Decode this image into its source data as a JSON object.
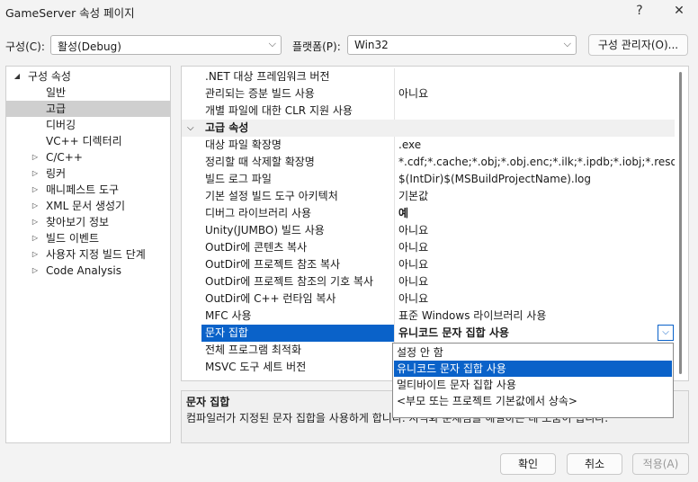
{
  "window": {
    "title": "GameServer 속성 페이지",
    "help": "?",
    "close": "✕"
  },
  "toolbar": {
    "config_label": "구성(C):",
    "config_value": "활성(Debug)",
    "platform_label": "플랫폼(P):",
    "platform_value": "Win32",
    "manager_button": "구성 관리자(O)..."
  },
  "tree": {
    "root": "구성 속성",
    "items": [
      "일반",
      "고급",
      "디버깅",
      "VC++ 디렉터리",
      "C/C++",
      "링커",
      "매니페스트 도구",
      "XML 문서 생성기",
      "찾아보기 정보",
      "빌드 이벤트",
      "사용자 지정 빌드 단계",
      "Code Analysis"
    ]
  },
  "grid": {
    "rows_top": [
      {
        "name": ".NET 대상 프레임워크 버전",
        "value": ""
      },
      {
        "name": "관리되는 증분 빌드 사용",
        "value": "아니요"
      },
      {
        "name": "개별 파일에 대한 CLR 지원 사용",
        "value": ""
      }
    ],
    "category": "고급 속성",
    "rows": [
      {
        "name": "대상 파일 확장명",
        "value": ".exe"
      },
      {
        "name": "정리할 때 삭제할 확장명",
        "value": "*.cdf;*.cache;*.obj;*.obj.enc;*.ilk;*.ipdb;*.iobj;*.resources;*.t"
      },
      {
        "name": "빌드 로그 파일",
        "value": "$(IntDir)$(MSBuildProjectName).log"
      },
      {
        "name": "기본 설정 빌드 도구 아키텍처",
        "value": "기본값"
      },
      {
        "name": "디버그 라이브러리 사용",
        "value": "예"
      },
      {
        "name": "Unity(JUMBO) 빌드 사용",
        "value": "아니요"
      },
      {
        "name": "OutDir에 콘텐츠 복사",
        "value": "아니요"
      },
      {
        "name": "OutDir에 프로젝트 참조 복사",
        "value": "아니요"
      },
      {
        "name": "OutDir에 프로젝트 참조의 기호 복사",
        "value": "아니요"
      },
      {
        "name": "OutDir에 C++ 런타임 복사",
        "value": "아니요"
      },
      {
        "name": "MFC 사용",
        "value": "표준 Windows 라이브러리 사용"
      },
      {
        "name": "문자 집합",
        "value": "유니코드 문자 집합 사용"
      },
      {
        "name": "전체 프로그램 최적화",
        "value": ""
      },
      {
        "name": "MSVC 도구 세트 버전",
        "value": ""
      }
    ]
  },
  "dropdown": {
    "options": [
      "설정 안 함",
      "유니코드 문자 집합 사용",
      "멀티바이트 문자 집합 사용",
      "<부모 또는 프로젝트 기본값에서 상속>"
    ],
    "highlighted": 1
  },
  "description": {
    "title": "문자 집합",
    "text": "컴파일러가 지정된 문자 집합을 사용하게 합니다. 지역화 문제점을 해결하는 데 도움이 됩니다."
  },
  "buttons": {
    "ok": "확인",
    "cancel": "취소",
    "apply": "적용(A)"
  },
  "colors": {
    "selection": "#0a62c9",
    "tree_selection": "#cfcfcf"
  }
}
